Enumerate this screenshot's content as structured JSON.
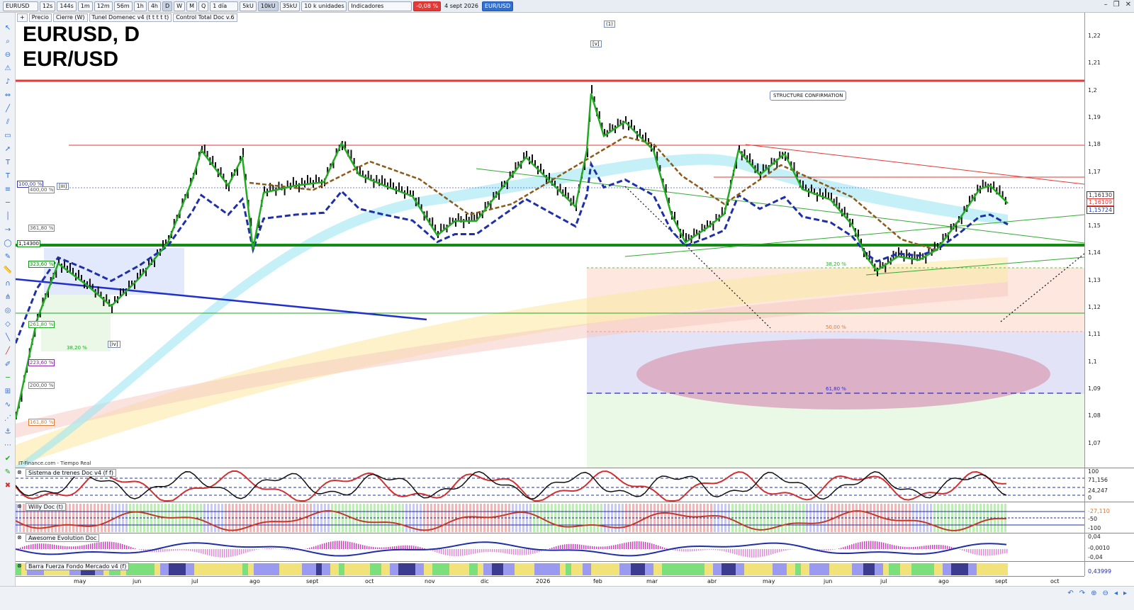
{
  "toolbar": {
    "symbol": "EURUSD",
    "timeframes": [
      "12s",
      "144s",
      "1m",
      "12m",
      "56m",
      "1h",
      "4h",
      "D",
      "W",
      "M",
      "Q"
    ],
    "period": "1 día",
    "units": [
      "5kU",
      "10kU",
      "35kU"
    ],
    "units_select": "10 k unidades",
    "indicators": "Indicadores",
    "change": "-0,08 %",
    "date": "4 sept 2026",
    "pair": "EUR/USD"
  },
  "subbar": {
    "items": [
      "Precio",
      "Cierre (W)",
      "Tunel Domenec v4 (t t t t t)",
      "Control Total Doc v.6"
    ]
  },
  "chart": {
    "title_line1": "EURUSD, D",
    "title_line2": "EUR/USD",
    "source": "IT-Finance.com - Tiempo Real",
    "wave_labels": [
      "(1)",
      "[v]",
      "[iii]",
      "[iv]"
    ],
    "structure_label": "STRUCTURE CONFIRMATION",
    "fib_left": [
      "100,00 %",
      "400,00 %",
      "361,80 %",
      "323,60 %",
      "261,80 %",
      "38,20 %",
      "223,60 %",
      "200,00 %",
      "161,80 %"
    ],
    "fib_right": [
      "38,20 %",
      "50,00 %",
      "61,80 %"
    ],
    "level_tag": "1,14300",
    "price_ticks": [
      "1,22",
      "1,21",
      "1,2",
      "1,19",
      "1,18",
      "1,17",
      "1,16",
      "1,15",
      "1,14",
      "1,13",
      "1,12",
      "1,11",
      "1,1",
      "1,09",
      "1,08",
      "1,07"
    ],
    "price_tags": [
      {
        "text": "1,16130",
        "color": "#333333"
      },
      {
        "text": "1,16109",
        "color": "#e53935"
      },
      {
        "text": "1,15724",
        "color": "#1f3fbf"
      }
    ],
    "colors": {
      "up": "#22aa22",
      "down": "#d32f2f",
      "ma_blue": "#1f2fa8",
      "ma_brown": "#8b5a1a",
      "resistance": "#e53935",
      "support": "#128c12"
    }
  },
  "panels": [
    {
      "title": "Sistema de trenes Doc v4 (f f)",
      "axis": [
        "100",
        "71,156",
        "24,247",
        "0"
      ]
    },
    {
      "title": "Willy Doc (t)",
      "axis": [
        "-27,110",
        "-50",
        "-100"
      ]
    },
    {
      "title": "Awesome Evolution Doc",
      "axis": [
        "0,04",
        "-0,0010",
        "-0,04"
      ]
    },
    {
      "title": "Barra Fuerza Fondo Mercado v4 (f)",
      "axis": [
        "0,43999"
      ]
    }
  ],
  "date_axis": [
    "may",
    "jun",
    "jul",
    "ago",
    "sept",
    "oct",
    "nov",
    "dic",
    "2026",
    "feb",
    "mar",
    "abr",
    "may",
    "jun",
    "jul",
    "ago",
    "sept",
    "oct"
  ]
}
